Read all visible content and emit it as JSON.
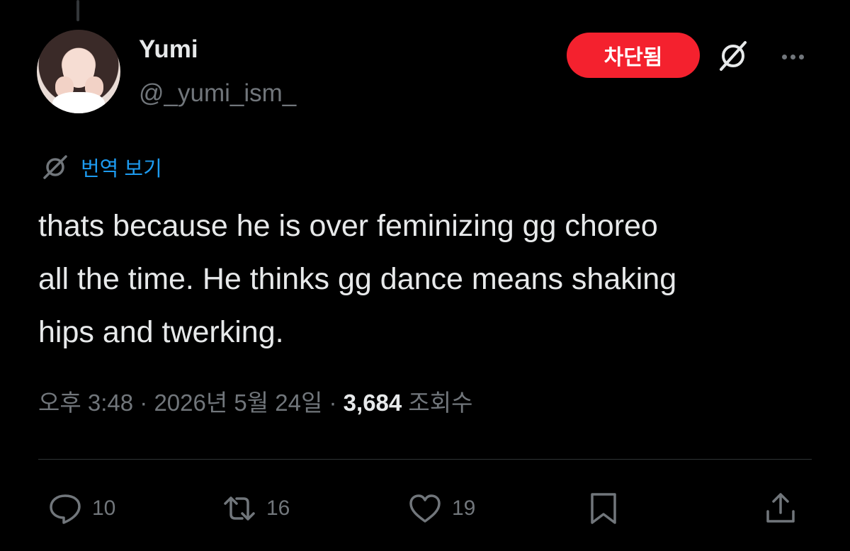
{
  "author": {
    "display_name": "Yumi",
    "handle": "@_yumi_ism_"
  },
  "header": {
    "blocked_label": "차단됨"
  },
  "translate_label": "번역 보기",
  "tweet": {
    "lines": [
      "thats because he is over feminizing gg choreo",
      "all the time. He thinks gg dance means shaking",
      "hips and twerking."
    ]
  },
  "meta": {
    "time": "오후 3:48",
    "separator": " · ",
    "date": "2026년 5월 24일",
    "views_count": "3,684",
    "views_label": " 조회수"
  },
  "actions": {
    "replies": "10",
    "reposts": "16",
    "likes": "19"
  },
  "icons": {
    "reply": "reply-icon",
    "repost": "repost-icon",
    "like": "heart-icon",
    "bookmark": "bookmark-icon",
    "share": "share-icon",
    "grok": "grok-icon",
    "more": "more-icon",
    "translate": "translate-icon"
  },
  "colors": {
    "background": "#000000",
    "text": "#e7e9ea",
    "muted": "#71767b",
    "accent_blue": "#1d9bf0",
    "blocked_red": "#f4212e"
  }
}
